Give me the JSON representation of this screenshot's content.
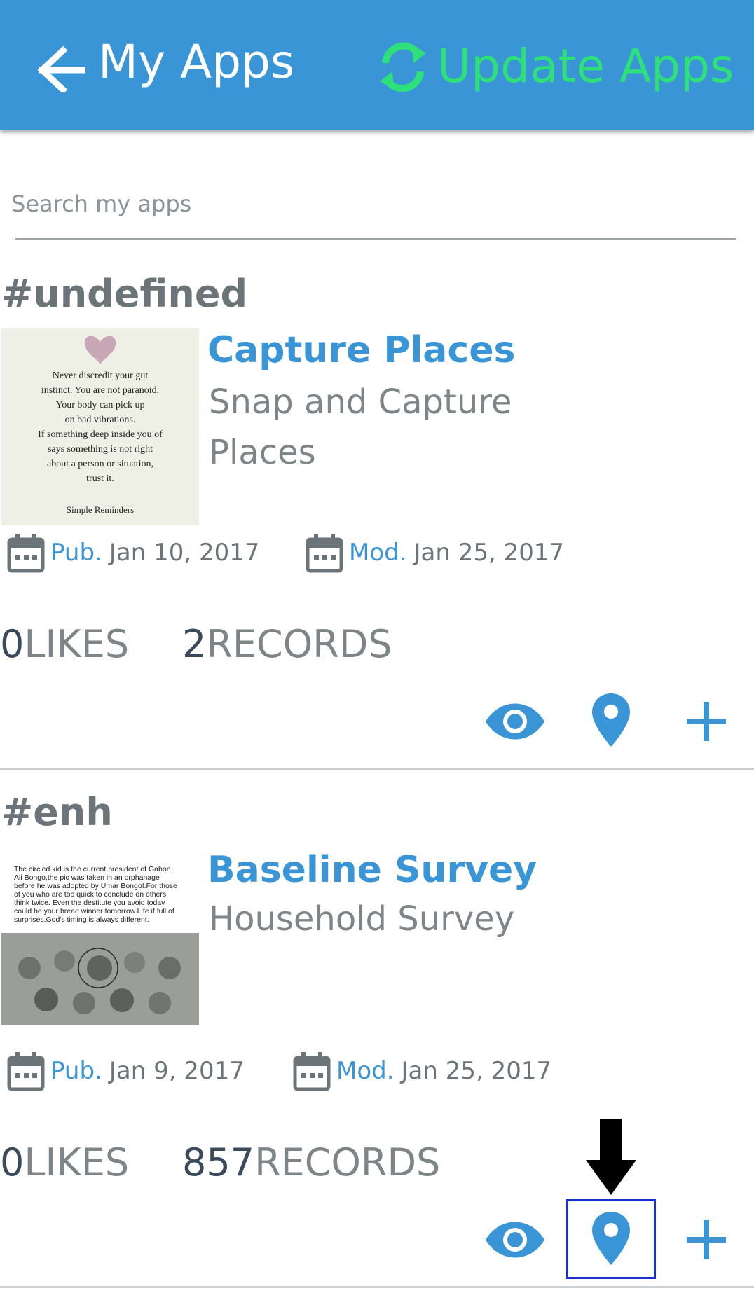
{
  "header": {
    "title": "My Apps",
    "update_label": "Update Apps",
    "bg_color": "#3a95d6",
    "update_color": "#2ee07a"
  },
  "search": {
    "placeholder": "Search my apps"
  },
  "apps": [
    {
      "tag": "#undefined",
      "title": "Capture Places",
      "description": "Snap and Capture Places",
      "thumbnail_text": "Never discredit your gut instinct. You are not paranoid. Your body can pick up on bad vibrations. If something deep inside you of says something is not right about a person or situation, trust it.",
      "thumbnail_credit": "Simple Reminders",
      "pub_label": "Pub.",
      "pub_date": "Jan 10, 2017",
      "mod_label": "Mod.",
      "mod_date": "Jan 25, 2017",
      "likes_count": "0",
      "likes_label": "LIKES",
      "records_count": "2",
      "records_label": "RECORDS"
    },
    {
      "tag": "#enh",
      "title": "Baseline Survey",
      "description": "Household Survey",
      "thumbnail_text": "The circled kid is the current president of Gabon Ali Bongo,the pic was taken in an orphanage before he was adopted by Umar Bongo!.For those of you who are too quick to conclude on others think twice. Even the destitute you avoid today could be your bread winner tomorrow.Life if full of surprises,God's timing is always different.",
      "pub_label": "Pub.",
      "pub_date": "Jan 9, 2017",
      "mod_label": "Mod.",
      "mod_date": "Jan 25, 2017",
      "likes_count": "0",
      "likes_label": "LIKES",
      "records_count": "857",
      "records_label": "RECORDS"
    }
  ],
  "icons": {
    "back": "arrow-left-icon",
    "update": "refresh-icon",
    "calendar": "calendar-icon",
    "view": "eye-icon",
    "map": "map-pin-icon",
    "add": "plus-icon"
  },
  "accent_color": "#3a95d6",
  "annotation_color": "#1a2fd0"
}
